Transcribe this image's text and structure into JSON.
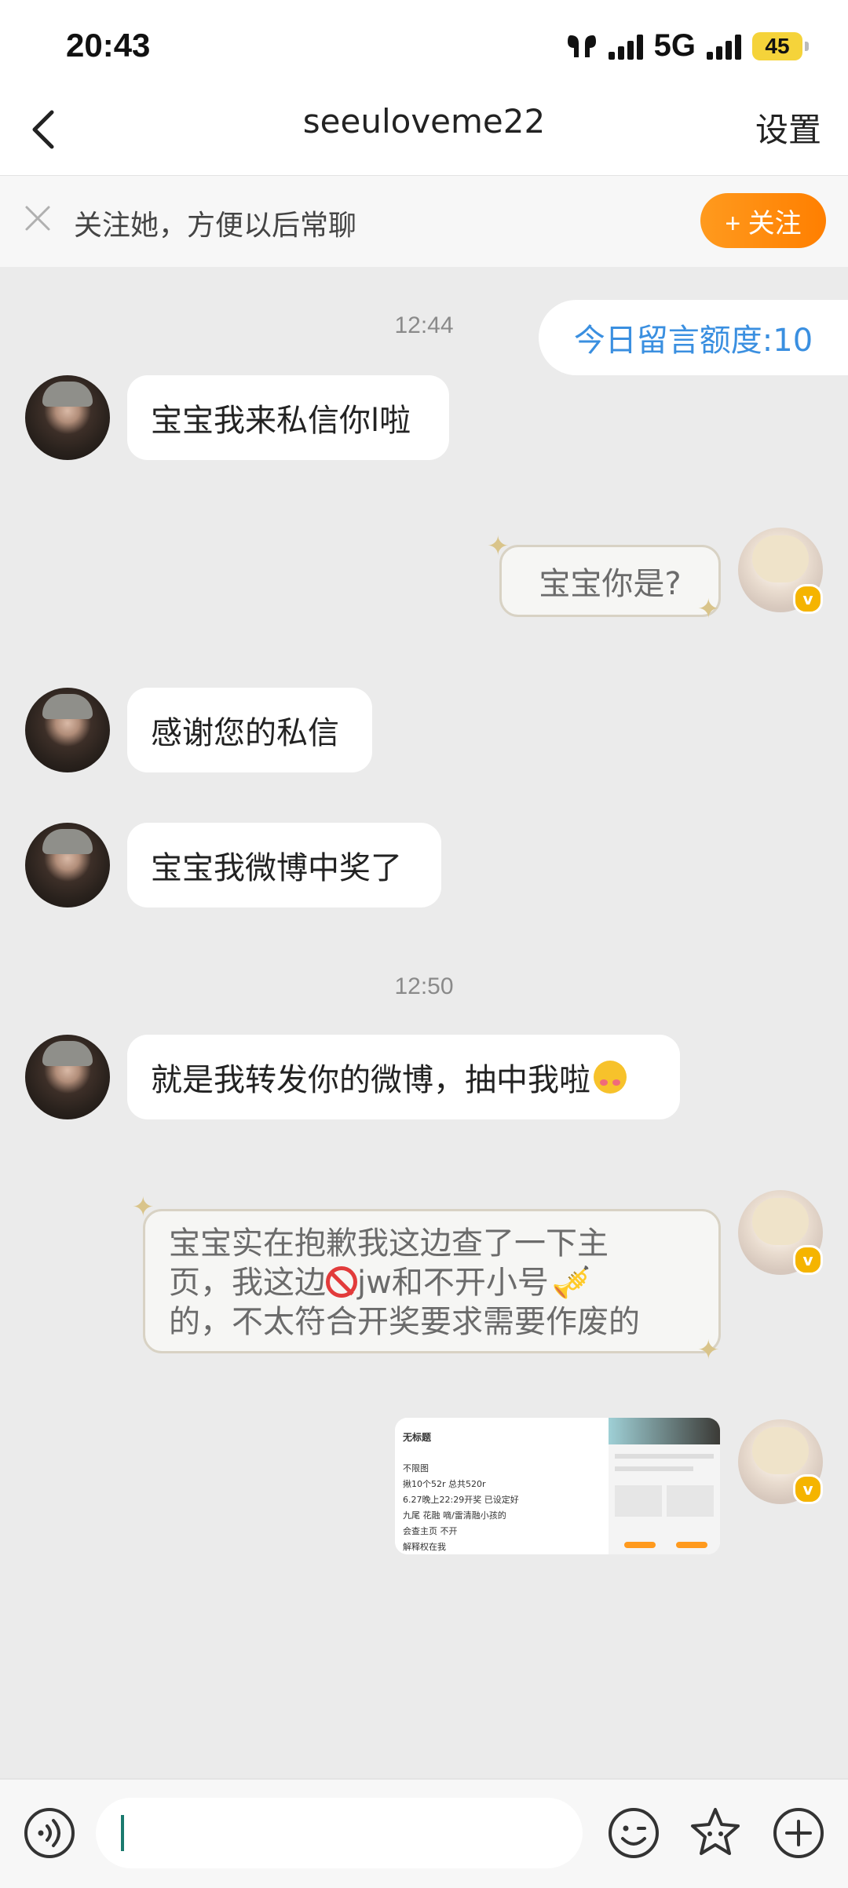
{
  "status_bar": {
    "time": "20:43",
    "network": "5G",
    "battery": "45"
  },
  "header": {
    "title": "seeuloveme22",
    "settings_label": "设置"
  },
  "follow_bar": {
    "text": "关注她，方便以后常聊",
    "button_label": "+ 关注"
  },
  "chat": {
    "quota_label": "今日留言额度:10",
    "timestamps": [
      "12:44",
      "12:50"
    ],
    "messages": [
      {
        "side": "in",
        "text": "宝宝我来私信你l啦"
      },
      {
        "side": "out",
        "text": "宝宝你是?"
      },
      {
        "side": "in",
        "text": "感谢您的私信"
      },
      {
        "side": "in",
        "text": "宝宝我微博中奖了"
      },
      {
        "side": "in",
        "text": "就是我转发你的微博，抽中我啦"
      },
      {
        "side": "out",
        "lines": [
          "宝宝实在抱歉我这边查了一下主",
          "页，我这边",
          "jw和不开小号",
          "的，不太符合开奖要求需要作废的"
        ]
      },
      {
        "side": "out",
        "type": "image"
      }
    ],
    "image_preview": {
      "title": "无标题",
      "lines": [
        "不限图",
        "揪10个52r 总共520r",
        "6.27晚上22:29开奖 已设定好",
        "九尾 花融 嘀/雷清融小孩的",
        "会查主页 不开",
        "解释权在我"
      ]
    }
  },
  "input_bar": {
    "placeholder": ""
  },
  "colors": {
    "accent_orange": "#ff8a00",
    "quota_blue": "#3a8fe0",
    "background": "#ebebeb",
    "badge_gold": "#f5b400"
  }
}
